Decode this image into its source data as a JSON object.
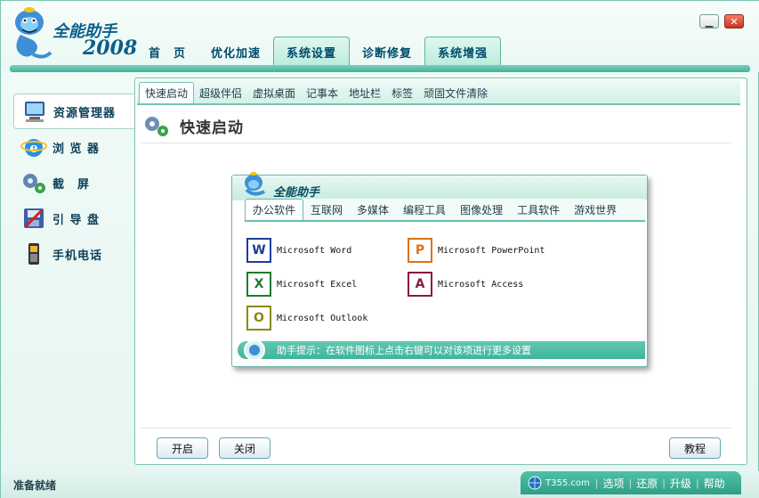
{
  "app": {
    "title": "全能助手",
    "year": "2008"
  },
  "main_tabs": [
    {
      "label": "首　页"
    },
    {
      "label": "优化加速"
    },
    {
      "label": "系统设置"
    },
    {
      "label": "诊断修复"
    },
    {
      "label": "系统增强"
    }
  ],
  "left_nav": [
    {
      "label": "资源管理器",
      "icon": "computer-icon"
    },
    {
      "label": "浏 览 器",
      "icon": "browser-icon"
    },
    {
      "label": "截　屏",
      "icon": "screenshot-gears-icon"
    },
    {
      "label": "引 导 盘",
      "icon": "boot-disk-icon"
    },
    {
      "label": "手机电话",
      "icon": "mobile-phone-icon"
    }
  ],
  "sub_tabs": [
    {
      "label": "快速启动"
    },
    {
      "label": "超级伴侣"
    },
    {
      "label": "虚拟桌面"
    },
    {
      "label": "记事本"
    },
    {
      "label": "地址栏"
    },
    {
      "label": "标签"
    },
    {
      "label": "顽固文件清除"
    }
  ],
  "section": {
    "title": "快速启动"
  },
  "preview": {
    "title": "全能助手",
    "tabs": [
      {
        "label": "办公软件"
      },
      {
        "label": "互联网"
      },
      {
        "label": "多媒体"
      },
      {
        "label": "编程工具"
      },
      {
        "label": "图像处理"
      },
      {
        "label": "工具软件"
      },
      {
        "label": "游戏世界"
      }
    ],
    "apps": [
      {
        "label": "Microsoft Word",
        "icon": "word-icon",
        "glyph": "W",
        "color": "#1f3c9c"
      },
      {
        "label": "Microsoft PowerPoint",
        "icon": "powerpoint-icon",
        "glyph": "P",
        "color": "#d9731b"
      },
      {
        "label": "Microsoft Excel",
        "icon": "excel-icon",
        "glyph": "X",
        "color": "#1e7a2f"
      },
      {
        "label": "Microsoft Access",
        "icon": "access-icon",
        "glyph": "A",
        "color": "#8a1b3c"
      },
      {
        "label": "Microsoft Outlook",
        "icon": "outlook-icon",
        "glyph": "O",
        "color": "#8a8a10"
      }
    ],
    "tip": "助手提示：在软件图标上点击右键可以对该项进行更多设置"
  },
  "buttons": {
    "open": "开启",
    "close": "关闭",
    "tutorial": "教程"
  },
  "status": {
    "text": "准备就绪",
    "site": "T355.com",
    "links": [
      {
        "label": "选项"
      },
      {
        "label": "还原"
      },
      {
        "label": "升级"
      },
      {
        "label": "帮助"
      }
    ]
  },
  "colors": {
    "accent": "#40b39d",
    "title_blue": "#0a5f8a",
    "close_red": "#c9361f"
  }
}
